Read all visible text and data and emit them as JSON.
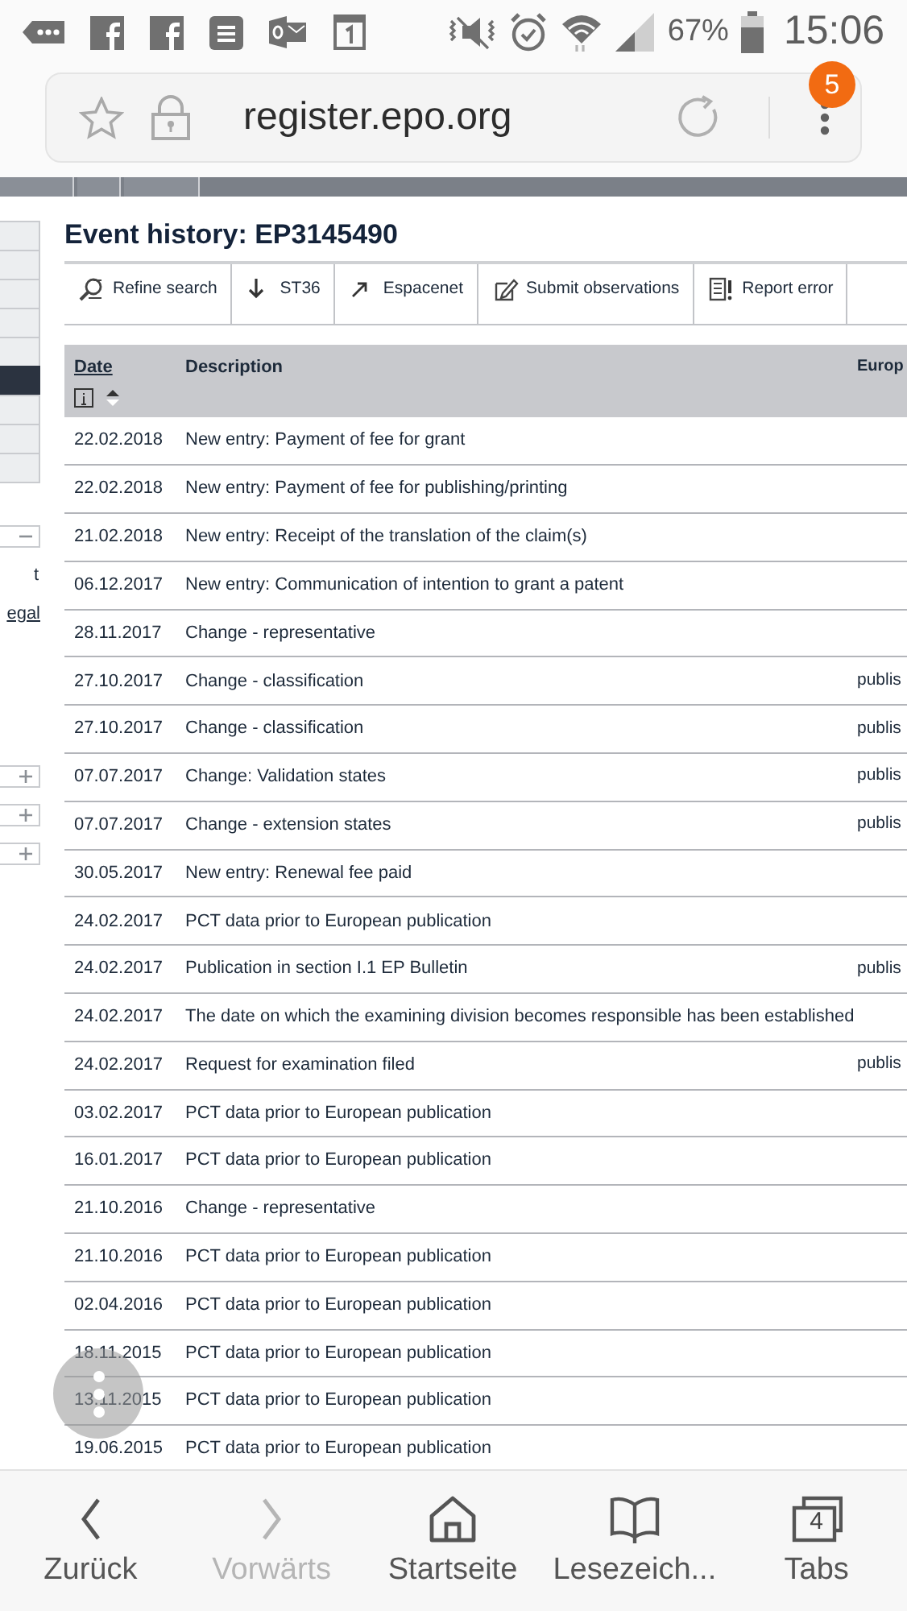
{
  "status_bar": {
    "battery": "67%",
    "time": "15:06"
  },
  "browser": {
    "url": "register.epo.org",
    "badge": "5"
  },
  "sidebar": {
    "menu": [
      {
        "selected": false
      },
      {
        "selected": false
      },
      {
        "selected": false
      },
      {
        "selected": false
      },
      {
        "selected": false
      },
      {
        "selected": true
      },
      {
        "selected": false
      },
      {
        "selected": false
      },
      {
        "selected": false
      }
    ],
    "text": "t",
    "link": "egal",
    "expanders": [
      {
        "expanded": true
      },
      {
        "expanded": false
      },
      {
        "expanded": false
      },
      {
        "expanded": false
      }
    ]
  },
  "page": {
    "title": "Event history: EP3145490",
    "toolbar": [
      {
        "label": "Refine search",
        "kind": "search"
      },
      {
        "label": "ST36",
        "kind": "download"
      },
      {
        "label": "Espacenet",
        "kind": "external"
      },
      {
        "label": "Submit observations",
        "kind": "edit"
      },
      {
        "label": "Report error",
        "kind": "error"
      }
    ],
    "table": {
      "columns": [
        "Date",
        "Description",
        "Europ"
      ],
      "rows": [
        {
          "date": "22.02.2018",
          "description": "New entry: Payment of fee for grant",
          "column_3": ""
        },
        {
          "date": "22.02.2018",
          "description": "New entry: Payment of fee for publishing/printing",
          "column_3": ""
        },
        {
          "date": "21.02.2018",
          "description": "New entry: Receipt of the translation of the claim(s)",
          "column_3": ""
        },
        {
          "date": "06.12.2017",
          "description": "New entry: Communication of intention to grant a patent",
          "column_3": ""
        },
        {
          "date": "28.11.2017",
          "description": "Change - representative",
          "column_3": ""
        },
        {
          "date": "27.10.2017",
          "description": "Change - classification",
          "column_3": "publis"
        },
        {
          "date": "27.10.2017",
          "description": "Change - classification",
          "column_3": "publis"
        },
        {
          "date": "07.07.2017",
          "description": "Change: Validation states",
          "column_3": "publis"
        },
        {
          "date": "07.07.2017",
          "description": "Change - extension states",
          "column_3": "publis"
        },
        {
          "date": "30.05.2017",
          "description": "New entry: Renewal fee paid",
          "column_3": ""
        },
        {
          "date": "24.02.2017",
          "description": "PCT data prior to European publication",
          "column_3": ""
        },
        {
          "date": "24.02.2017",
          "description": "Publication in section I.1 EP Bulletin",
          "column_3": "publis"
        },
        {
          "date": "24.02.2017",
          "description": "The date on which the examining division becomes responsible has been established",
          "column_3": ""
        },
        {
          "date": "24.02.2017",
          "description": "Request for examination filed",
          "column_3": "publis"
        },
        {
          "date": "03.02.2017",
          "description": "PCT data prior to European publication",
          "column_3": ""
        },
        {
          "date": "16.01.2017",
          "description": "PCT data prior to European publication",
          "column_3": ""
        },
        {
          "date": "21.10.2016",
          "description": "Change - representative",
          "column_3": ""
        },
        {
          "date": "21.10.2016",
          "description": "PCT data prior to European publication",
          "column_3": ""
        },
        {
          "date": "02.04.2016",
          "description": "PCT data prior to European publication",
          "column_3": ""
        },
        {
          "date": "18.11.2015",
          "description": "PCT data prior to European publication",
          "column_3": ""
        },
        {
          "date": "13.11.2015",
          "description": "PCT data prior to European publication",
          "column_3": ""
        },
        {
          "date": "19.06.2015",
          "description": "PCT data prior to European publication",
          "column_3": ""
        }
      ]
    }
  },
  "bottom_nav": [
    {
      "label": "Zurück",
      "kind": "back",
      "disabled": false
    },
    {
      "label": "Vorwärts",
      "kind": "forward",
      "disabled": true
    },
    {
      "label": "Startseite",
      "kind": "home",
      "disabled": false
    },
    {
      "label": "Lesezeich...",
      "kind": "bookmarks",
      "disabled": false
    },
    {
      "label": "Tabs",
      "kind": "tabs",
      "disabled": false,
      "count": "4"
    }
  ]
}
